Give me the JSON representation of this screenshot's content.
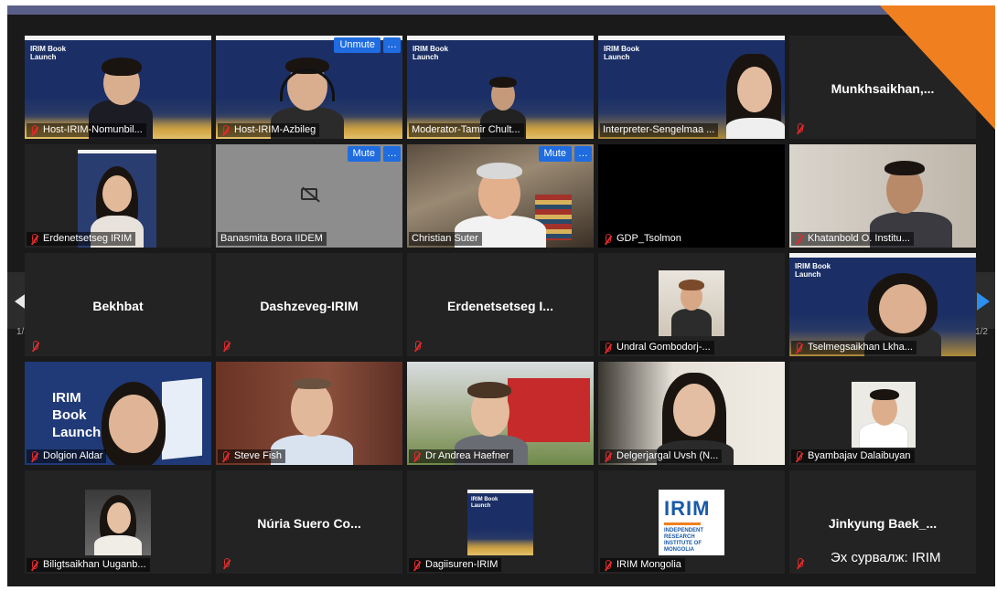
{
  "meeting": {
    "page_indicator_left": "1/2",
    "page_indicator_right": "1/2",
    "source_caption": "Эх сурвалж: IRIM"
  },
  "launch_banner": {
    "title": "IRIM Book Launch"
  },
  "video_launch_big": "IRIM Book Launch",
  "buttons": {
    "unmute": "Unmute",
    "mute": "Mute",
    "more": "…"
  },
  "tiles": [
    {
      "name": "Host-IRIM-Nomunbil..."
    },
    {
      "name": "Host-IRIM-Azbileg"
    },
    {
      "name": "Moderator-Tamir Chult..."
    },
    {
      "name": "Interpreter-Sengelmaa ..."
    },
    {
      "name": "Munkhsaikhan,..."
    },
    {
      "name": "Erdenetsetseg IRIM"
    },
    {
      "name": "Banasmita Bora IIDEM"
    },
    {
      "name": "Christian Suter"
    },
    {
      "name": "GDP_Tsolmon"
    },
    {
      "name": "Khatanbold O. Institu..."
    },
    {
      "name": "Bekhbat"
    },
    {
      "name": "Dashzeveg-IRIM"
    },
    {
      "name": "Erdenetsetseg I..."
    },
    {
      "name": "Undral Gombodorj-..."
    },
    {
      "name": "Tselmegsaikhan Lkha..."
    },
    {
      "name": "Dolgion Aldar"
    },
    {
      "name": "Steve Fish"
    },
    {
      "name": "Dr Andrea Haefner"
    },
    {
      "name": "Delgerjargal Uvsh (N..."
    },
    {
      "name": "Byambajav Dalaibuyan"
    },
    {
      "name": "Biligtsaikhan Uuganb..."
    },
    {
      "name": "Núria Suero Co..."
    },
    {
      "name": "Dagiisuren-IRIM"
    },
    {
      "name": "IRIM Mongolia"
    },
    {
      "name": "Jinkyung Baek_..."
    }
  ],
  "irim_logo": {
    "wordmark": "IRIM",
    "subtitle": "INDEPENDENT RESEARCH INSTITUTE OF MONGOLIA"
  },
  "colors": {
    "accent_button": "#1f6ce0",
    "active_speaker_border": "#c6d655",
    "muted_mic": "#e02b2b",
    "corner_ribbon": "#f0801f"
  }
}
